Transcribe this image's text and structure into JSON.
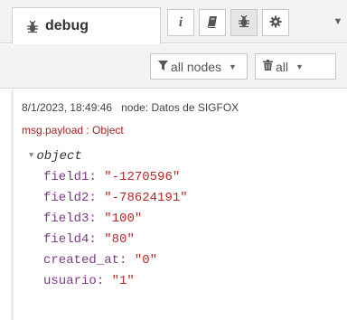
{
  "tab": {
    "title": "debug",
    "icon": "bug-icon"
  },
  "toolbar_buttons": [
    {
      "name": "info-icon",
      "glyph": "i"
    },
    {
      "name": "book-icon",
      "glyph": "book"
    },
    {
      "name": "bug-icon",
      "glyph": "bug",
      "active": true
    },
    {
      "name": "gear-icon",
      "glyph": "gear"
    }
  ],
  "filter": {
    "nodes_label": "all nodes",
    "clear_label": "all"
  },
  "message": {
    "timestamp": "8/1/2023, 18:49:46",
    "node": "node: Datos de SIGFOX",
    "type": "msg.payload : Object",
    "root_label": "object",
    "fields": [
      {
        "key": "field1",
        "value": "\"-1270596\""
      },
      {
        "key": "field2",
        "value": "\"-78624191\""
      },
      {
        "key": "field3",
        "value": "\"100\""
      },
      {
        "key": "field4",
        "value": "\"80\""
      },
      {
        "key": "created_at",
        "value": "\"0\""
      },
      {
        "key": "usuario",
        "value": "\"1\""
      }
    ]
  },
  "colors": {
    "key": "#7e3887",
    "string": "#b72828",
    "type": "#a52222"
  }
}
